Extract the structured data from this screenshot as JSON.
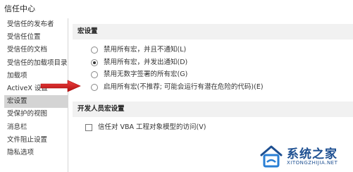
{
  "window": {
    "title": "信任中心"
  },
  "sidebar": {
    "items": [
      {
        "label": "受信任的发布者"
      },
      {
        "label": "受信任位置"
      },
      {
        "label": "受信任的文档"
      },
      {
        "label": "受信任的加载项目录"
      },
      {
        "label": "加载项"
      },
      {
        "label": "ActiveX 设置"
      },
      {
        "label": "宏设置"
      },
      {
        "label": "受保护的视图"
      },
      {
        "label": "消息栏"
      },
      {
        "label": "文件阻止设置"
      },
      {
        "label": "隐私选项"
      }
    ],
    "selected": "宏设置"
  },
  "macro_settings": {
    "header": "宏设置",
    "options": [
      {
        "label": "禁用所有宏，并且不通知(L)",
        "checked": false
      },
      {
        "label": "禁用所有宏，并发出通知(D)",
        "checked": true
      },
      {
        "label": "禁用无数字签署的所有宏(G)",
        "checked": false
      },
      {
        "label": "启用所有宏(不推荐; 可能会运行有潜在危险的代码)(E)",
        "checked": false
      }
    ]
  },
  "developer_settings": {
    "header": "开发人员宏设置",
    "trust_vba": {
      "label": "信任对 VBA 工程对象模型的访问(V)",
      "checked": false
    }
  },
  "watermark": {
    "name": "系统之家",
    "url": "XITONGZHIJIA.NET"
  },
  "colors": {
    "arrow": "#e02020",
    "selected_bg": "#d4d4d4",
    "section_bg": "#f1f1f1",
    "watermark": "#1d4f91"
  }
}
